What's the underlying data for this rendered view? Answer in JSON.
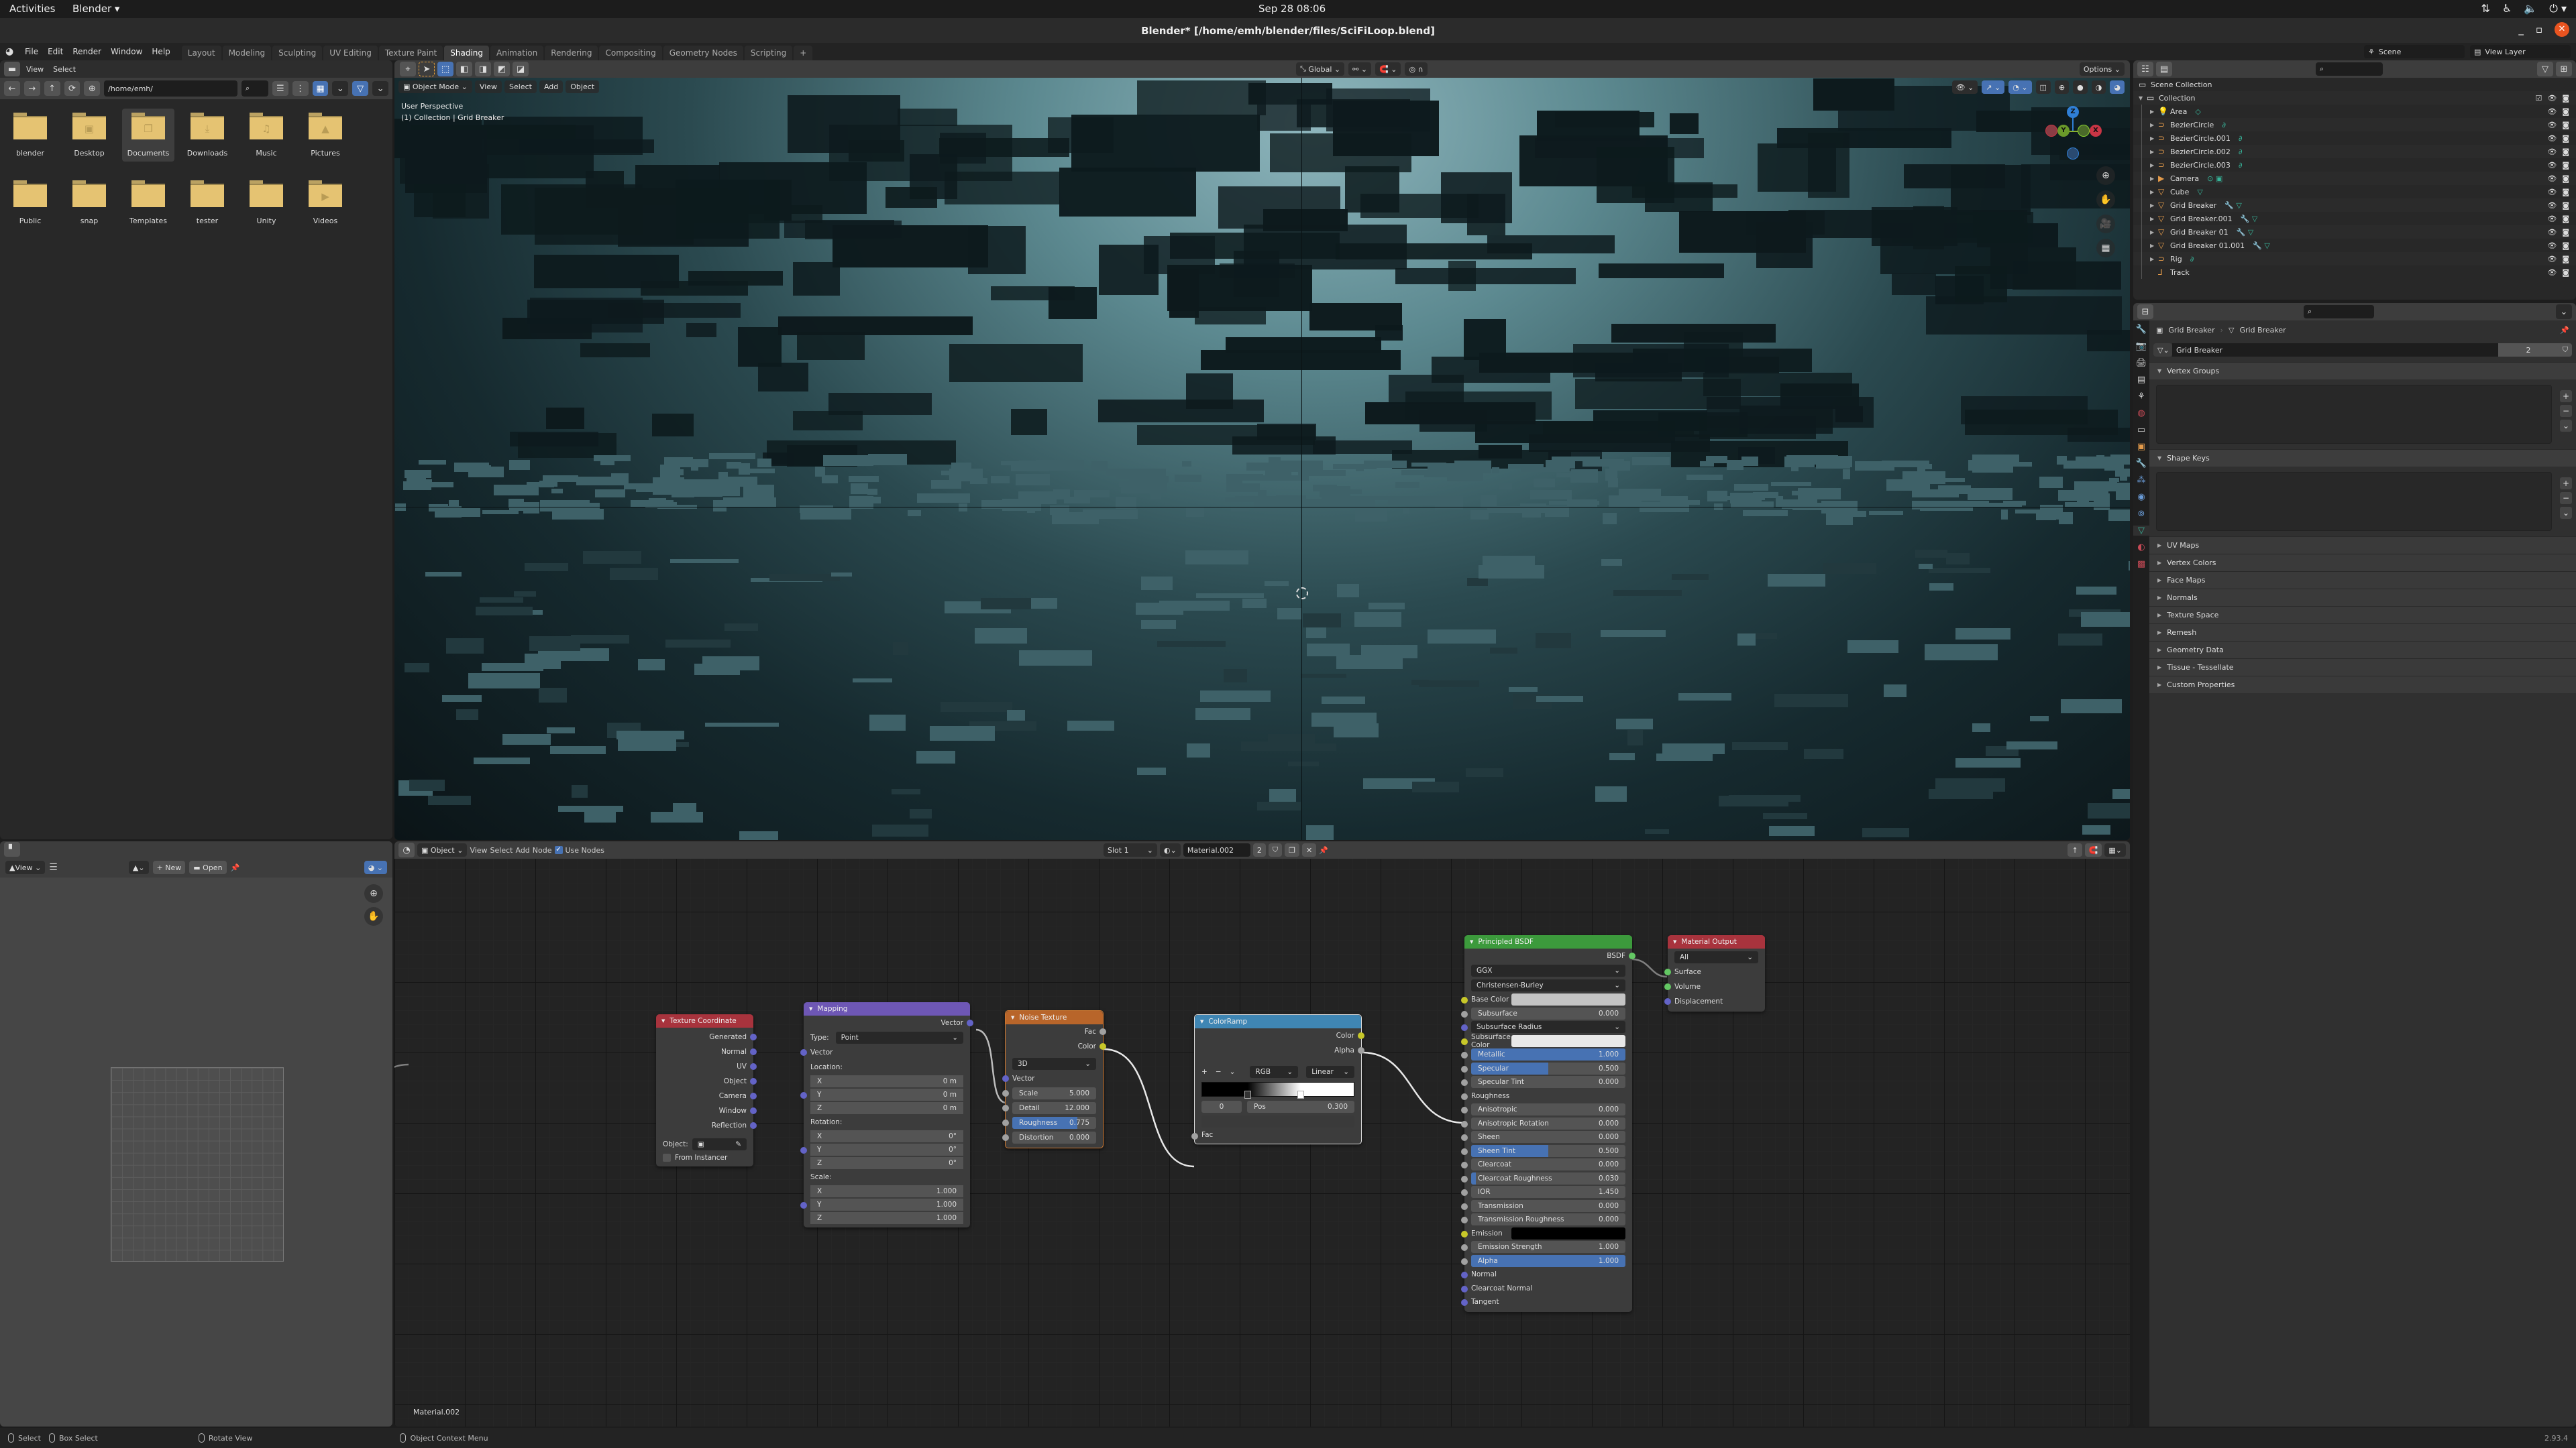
{
  "os": {
    "activities": "Activities",
    "app_menu": "Blender ▾",
    "clock": "Sep 28  08:06",
    "tray_icons": [
      "network-icon",
      "accessibility-icon",
      "volume-icon",
      "power-icon"
    ]
  },
  "window": {
    "title": "Blender* [/home/emh/blender/files/SciFiLoop.blend]",
    "controls": [
      "minimize",
      "maximize",
      "close"
    ]
  },
  "topbar": {
    "menus": [
      "File",
      "Edit",
      "Render",
      "Window",
      "Help"
    ],
    "workspaces": [
      "Layout",
      "Modeling",
      "Sculpting",
      "UV Editing",
      "Texture Paint",
      "Shading",
      "Animation",
      "Rendering",
      "Compositing",
      "Geometry Nodes",
      "Scripting"
    ],
    "active_workspace": "Shading",
    "add_tab": "+",
    "scene": "Scene",
    "view_layer": "View Layer"
  },
  "file_browser": {
    "menus": [
      "View",
      "Select"
    ],
    "path": "/home/emh/",
    "folders": [
      {
        "name": "blender",
        "icon": ""
      },
      {
        "name": "Desktop",
        "icon": "▣"
      },
      {
        "name": "Documents",
        "icon": "❐",
        "selected": true
      },
      {
        "name": "Downloads",
        "icon": "⤓"
      },
      {
        "name": "Music",
        "icon": "♫"
      },
      {
        "name": "Pictures",
        "icon": "▲"
      },
      {
        "name": "Public",
        "icon": ""
      },
      {
        "name": "snap",
        "icon": ""
      },
      {
        "name": "Templates",
        "icon": ""
      },
      {
        "name": "tester",
        "icon": ""
      },
      {
        "name": "Unity",
        "icon": ""
      },
      {
        "name": "Videos",
        "icon": "▶"
      }
    ]
  },
  "viewport": {
    "mode": "Object Mode",
    "menus": [
      "View",
      "Select",
      "Add",
      "Object"
    ],
    "orientation": "Global",
    "options_label": "Options",
    "info_line1": "User Perspective",
    "info_line2": "(1) Collection | Grid Breaker",
    "gizmo_axes": [
      "Z",
      "Y",
      "X"
    ]
  },
  "outliner": {
    "root": "Scene Collection",
    "collection": "Collection",
    "items": [
      {
        "name": "Area",
        "icon": "💡",
        "extra": "◇"
      },
      {
        "name": "BezierCircle",
        "icon": "⊃",
        "extra": "∂"
      },
      {
        "name": "BezierCircle.001",
        "icon": "⊃",
        "extra": "∂"
      },
      {
        "name": "BezierCircle.002",
        "icon": "⊃",
        "extra": "∂"
      },
      {
        "name": "BezierCircle.003",
        "icon": "⊃",
        "extra": "∂"
      },
      {
        "name": "Camera",
        "icon": "▶",
        "extra": "⊙ ▣"
      },
      {
        "name": "Cube",
        "icon": "▽",
        "extra": "▽"
      },
      {
        "name": "Grid Breaker",
        "icon": "▽",
        "extra": "🔧 ▽"
      },
      {
        "name": "Grid Breaker.001",
        "icon": "▽",
        "extra": "🔧 ▽"
      },
      {
        "name": "Grid Breaker 01",
        "icon": "▽",
        "extra": "🔧 ▽"
      },
      {
        "name": "Grid Breaker 01.001",
        "icon": "▽",
        "extra": "🔧 ▽"
      },
      {
        "name": "Rig",
        "icon": "⊃",
        "extra": "∂"
      },
      {
        "name": "Track",
        "icon": "⅃",
        "extra": ""
      }
    ]
  },
  "properties": {
    "breadcrumb_object": "Grid Breaker",
    "breadcrumb_data": "Grid Breaker",
    "mesh_name": "Grid Breaker",
    "users": "2",
    "open_panels": [
      "Vertex Groups",
      "Shape Keys"
    ],
    "closed_panels": [
      "UV Maps",
      "Vertex Colors",
      "Face Maps",
      "Normals",
      "Texture Space",
      "Remesh",
      "Geometry Data",
      "Tissue - Tessellate",
      "Custom Properties"
    ]
  },
  "image_editor": {
    "view_label": "View",
    "new_label": "New",
    "open_label": "Open"
  },
  "node_editor": {
    "object_label": "Object",
    "menus": [
      "View",
      "Select",
      "Add",
      "Node"
    ],
    "use_nodes_label": "Use Nodes",
    "use_nodes": true,
    "slot": "Slot 1",
    "material": "Material.002",
    "material_users": "2",
    "material_label": "Material.002",
    "nodes": {
      "texcoord": {
        "title": "Texture Coordinate",
        "outputs": [
          "Generated",
          "Normal",
          "UV",
          "Object",
          "Camera",
          "Window",
          "Reflection"
        ],
        "object_label": "Object:",
        "from_instancer": "From Instancer"
      },
      "mapping": {
        "title": "Mapping",
        "output": "Vector",
        "type_label": "Type:",
        "type": "Point",
        "input_vector": "Vector",
        "location_label": "Location:",
        "location": [
          {
            "axis": "X",
            "value": "0 m"
          },
          {
            "axis": "Y",
            "value": "0 m"
          },
          {
            "axis": "Z",
            "value": "0 m"
          }
        ],
        "rotation_label": "Rotation:",
        "rotation": [
          {
            "axis": "X",
            "value": "0°"
          },
          {
            "axis": "Y",
            "value": "0°"
          },
          {
            "axis": "Z",
            "value": "0°"
          }
        ],
        "scale_label": "Scale:",
        "scale": [
          {
            "axis": "X",
            "value": "1.000"
          },
          {
            "axis": "Y",
            "value": "1.000"
          },
          {
            "axis": "Z",
            "value": "1.000"
          }
        ]
      },
      "noise": {
        "title": "Noise Texture",
        "outputs": [
          "Fac",
          "Color"
        ],
        "dimensions": "3D",
        "input_vector": "Vector",
        "fields": [
          {
            "label": "Scale",
            "value": "5.000",
            "fill": 0
          },
          {
            "label": "Detail",
            "value": "12.000",
            "fill": 0
          },
          {
            "label": "Roughness",
            "value": "0.775",
            "fill": 0.775
          },
          {
            "label": "Distortion",
            "value": "0.000",
            "fill": 0
          }
        ]
      },
      "colorramp": {
        "title": "ColorRamp",
        "outputs": [
          "Color",
          "Alpha"
        ],
        "color_mode": "RGB",
        "interpolation": "Linear",
        "stop_index": "0",
        "pos_label": "Pos",
        "pos_value": "0.300",
        "stops": [
          0.3,
          0.65
        ],
        "input": "Fac"
      },
      "bsdf": {
        "title": "Principled BSDF",
        "output": "BSDF",
        "distribution": "GGX",
        "subsurface_method": "Christensen-Burley",
        "rows": [
          {
            "label": "Base Color",
            "kind": "color",
            "color": "#c4c4c4",
            "sock": "col"
          },
          {
            "label": "Subsurface",
            "value": "0.000",
            "fill": 0,
            "sock": "flt"
          },
          {
            "label": "Subsurface Radius",
            "kind": "dropdown",
            "sock": "vec"
          },
          {
            "label": "Subsurface Color",
            "kind": "color",
            "color": "#e8e8e8",
            "sock": "col"
          },
          {
            "label": "Metallic",
            "value": "1.000",
            "fill": 1,
            "sock": "flt"
          },
          {
            "label": "Specular",
            "value": "0.500",
            "fill": 0.5,
            "sock": "flt"
          },
          {
            "label": "Specular Tint",
            "value": "0.000",
            "fill": 0,
            "sock": "flt"
          },
          {
            "label": "Roughness",
            "kind": "label",
            "sock": "flt"
          },
          {
            "label": "Anisotropic",
            "value": "0.000",
            "fill": 0,
            "sock": "flt"
          },
          {
            "label": "Anisotropic Rotation",
            "value": "0.000",
            "fill": 0,
            "sock": "flt"
          },
          {
            "label": "Sheen",
            "value": "0.000",
            "fill": 0,
            "sock": "flt"
          },
          {
            "label": "Sheen Tint",
            "value": "0.500",
            "fill": 0.5,
            "sock": "flt"
          },
          {
            "label": "Clearcoat",
            "value": "0.000",
            "fill": 0,
            "sock": "flt"
          },
          {
            "label": "Clearcoat Roughness",
            "value": "0.030",
            "fill": 0.03,
            "sock": "flt"
          },
          {
            "label": "IOR",
            "value": "1.450",
            "fill": 0,
            "sock": "flt"
          },
          {
            "label": "Transmission",
            "value": "0.000",
            "fill": 0,
            "sock": "flt"
          },
          {
            "label": "Transmission Roughness",
            "value": "0.000",
            "fill": 0,
            "sock": "flt"
          },
          {
            "label": "Emission",
            "kind": "color",
            "color": "#000000",
            "sock": "col"
          },
          {
            "label": "Emission Strength",
            "value": "1.000",
            "fill": 0,
            "sock": "flt"
          },
          {
            "label": "Alpha",
            "value": "1.000",
            "fill": 1,
            "sock": "flt"
          },
          {
            "label": "Normal",
            "kind": "label",
            "sock": "vec"
          },
          {
            "label": "Clearcoat Normal",
            "kind": "label",
            "sock": "vec"
          },
          {
            "label": "Tangent",
            "kind": "label",
            "sock": "vec"
          }
        ]
      },
      "output": {
        "title": "Material Output",
        "target": "All",
        "inputs": [
          {
            "label": "Surface",
            "sock": "sh"
          },
          {
            "label": "Volume",
            "sock": "sh"
          },
          {
            "label": "Displacement",
            "sock": "vec"
          }
        ]
      }
    }
  },
  "statusbar": {
    "select": "Select",
    "box_select": "Box Select",
    "rotate_view": "Rotate View",
    "context_menu": "Object Context Menu",
    "version": "2.93.4"
  },
  "colors": {
    "accent": "#4772b3",
    "texcoord_header": "#a8333d",
    "mapping_header": "#6e57b5",
    "noise_header": "#b8652a",
    "colorramp_header": "#3f86b4",
    "bsdf_header": "#3c9a3c",
    "output_header": "#a8333d",
    "folder": "#e5c372"
  }
}
